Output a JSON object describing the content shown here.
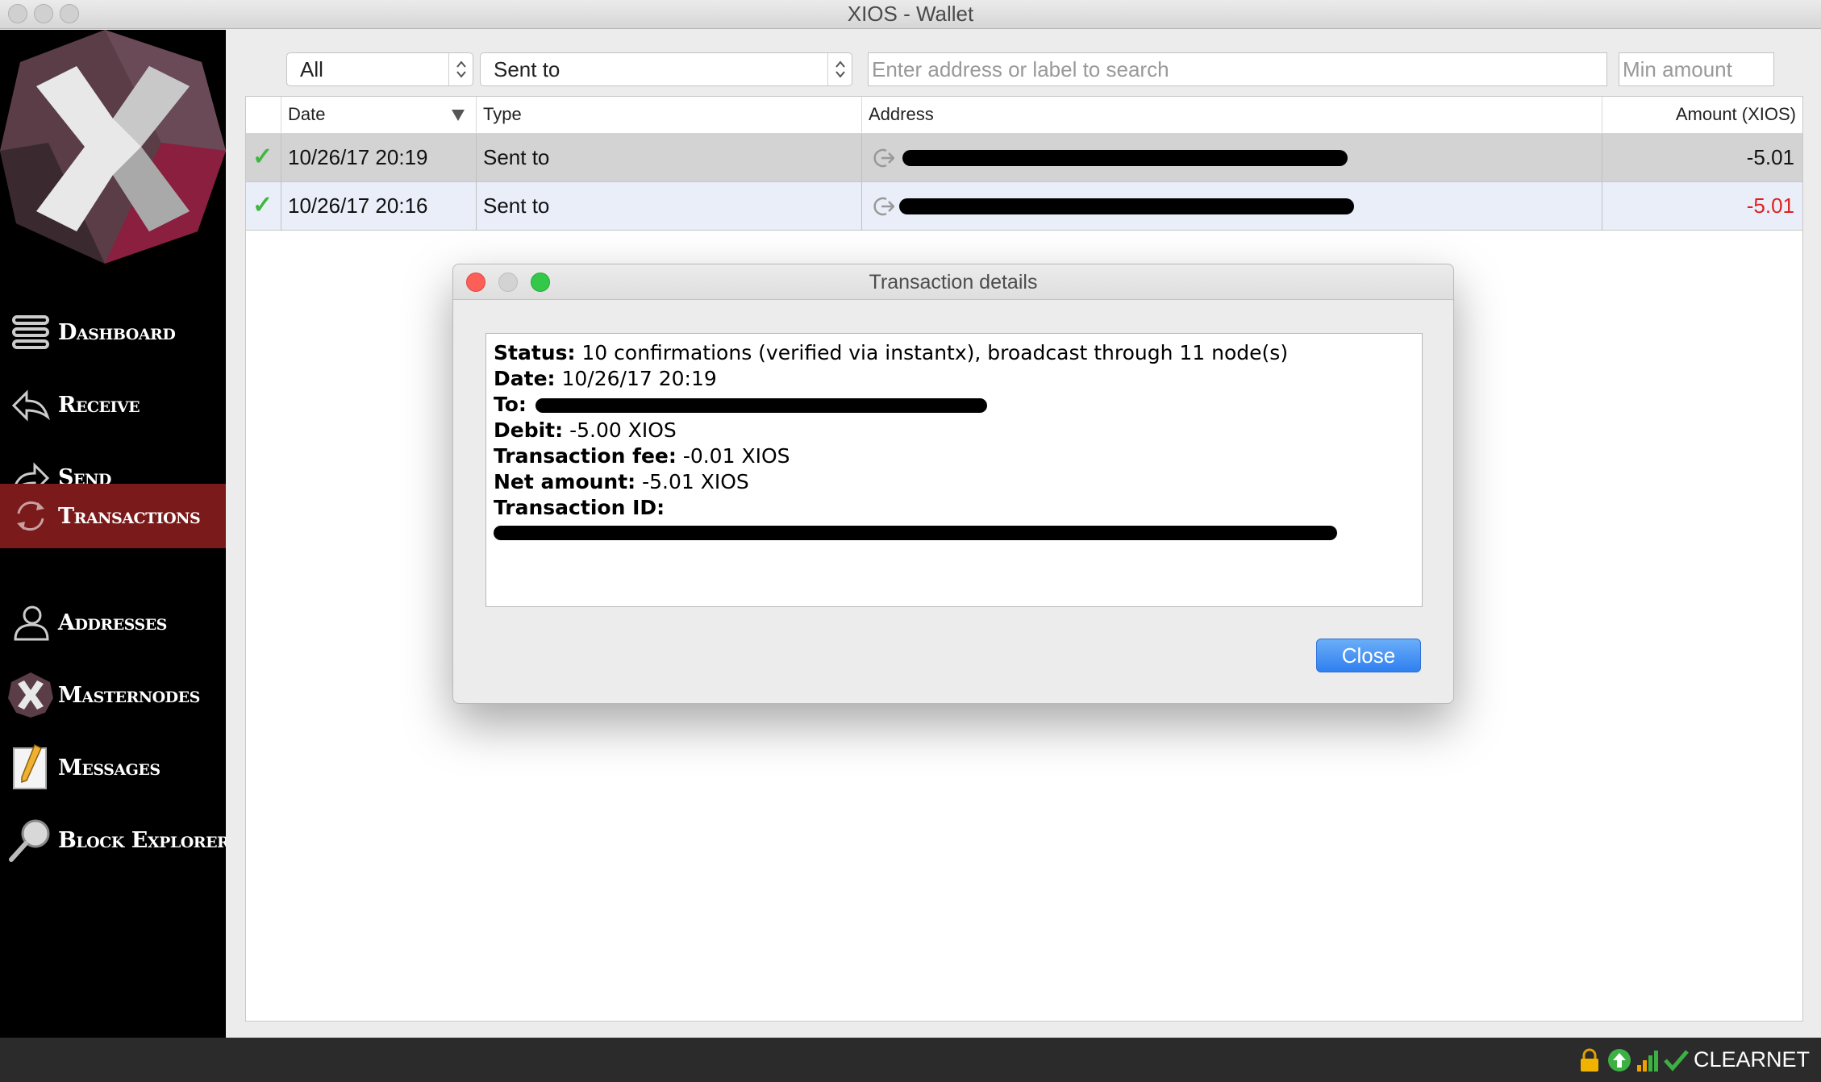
{
  "window": {
    "title": "XIOS - Wallet"
  },
  "sidebar": {
    "items": [
      {
        "label": "Dashboard",
        "icon": "dashboard-icon",
        "active": false
      },
      {
        "label": "Receive",
        "icon": "receive-arrow-icon",
        "active": false
      },
      {
        "label": "Send",
        "icon": "send-arrow-icon",
        "active": false
      },
      {
        "label": "Transactions",
        "icon": "transactions-cycle-icon",
        "active": true
      },
      {
        "label": "Addresses",
        "icon": "addresses-person-icon",
        "active": false
      },
      {
        "label": "Masternodes",
        "icon": "masternodes-x-icon",
        "active": false
      },
      {
        "label": "Messages",
        "icon": "messages-notepad-icon",
        "active": false
      },
      {
        "label": "Block Explorer",
        "icon": "magnifier-icon",
        "active": false
      }
    ]
  },
  "filters": {
    "date_select": "All",
    "type_select": "Sent to",
    "search_placeholder": "Enter address or label to search",
    "min_amount_placeholder": "Min amount"
  },
  "table": {
    "headers": {
      "date": "Date",
      "type": "Type",
      "address": "Address",
      "amount": "Amount (XIOS)"
    },
    "rows": [
      {
        "date": "10/26/17 20:19",
        "type": "Sent to",
        "amount": "-5.01",
        "selected": true
      },
      {
        "date": "10/26/17 20:16",
        "type": "Sent to",
        "amount": "-5.01",
        "selected": false
      }
    ]
  },
  "dialog": {
    "title": "Transaction details",
    "status_label": "Status:",
    "status_value": "10 confirmations (verified via instantx), broadcast through 11 node(s)",
    "date_label": "Date:",
    "date_value": "10/26/17 20:19",
    "to_label": "To:",
    "debit_label": "Debit:",
    "debit_value": "-5.00 XIOS",
    "fee_label": "Transaction fee:",
    "fee_value": "-0.01 XIOS",
    "net_label": "Net amount:",
    "net_value": "-5.01 XIOS",
    "txid_label": "Transaction ID:",
    "close_label": "Close"
  },
  "statusbar": {
    "network": "CLEARNET"
  },
  "colors": {
    "sidebar_bg": "#000000",
    "active_nav_bg": "#7a1a1a",
    "negative_amount": "#e02020",
    "confirm_check": "#3fb83f",
    "close_button": "#2f7ff0"
  }
}
